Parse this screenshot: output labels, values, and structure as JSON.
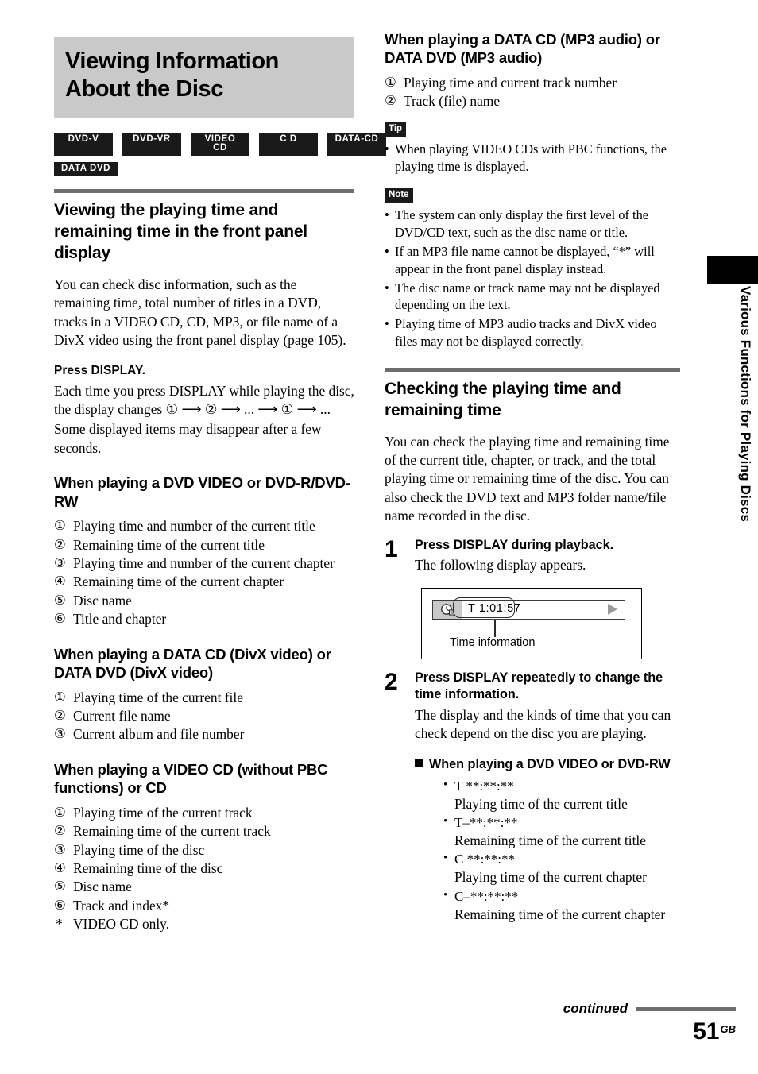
{
  "document": {
    "title": "Viewing Information About the Disc",
    "side_tab_text": "Various Functions for Playing Discs",
    "footer": {
      "continued_label": "continued",
      "page_number": "51",
      "page_suffix": "GB"
    }
  },
  "disc_badges": {
    "row1": [
      "DVD-V",
      "DVD-VR",
      "VIDEO CD",
      "C D",
      "DATA-CD"
    ],
    "row2": [
      "DATA DVD"
    ]
  },
  "left_column": {
    "section1": {
      "heading": "Viewing the playing time and remaining time in the front panel display",
      "paragraph": "You can check disc information, such as the remaining time, total number of titles in a DVD, tracks in a VIDEO CD, CD, MP3, or file name of a DivX video using the front panel display (page 105).",
      "press_display_heading": "Press DISPLAY.",
      "press_display_text_1": "Each time you press DISPLAY while playing the disc, the display changes ",
      "press_display_text_2": "Some displayed items may disappear after a few seconds."
    },
    "dvd_video_block": {
      "heading": "When playing a DVD VIDEO or DVD-R/DVD-RW",
      "items": [
        "Playing time and number of the current title",
        "Remaining time of the current title",
        "Playing time and number of the current chapter",
        "Remaining time of the current chapter",
        "Disc name",
        "Title and chapter"
      ]
    },
    "divx_block": {
      "heading": "When playing a DATA CD (DivX video) or DATA DVD (DivX video)",
      "items": [
        "Playing time of the current file",
        "Current file name",
        "Current album and file number"
      ]
    },
    "videocd_block": {
      "heading": "When playing a VIDEO CD (without PBC functions) or CD",
      "items": [
        "Playing time of the current track",
        "Remaining time of the current track",
        "Playing time of the disc",
        "Remaining time of the disc",
        "Disc name",
        "Track and index*"
      ],
      "footnote": "VIDEO CD only."
    }
  },
  "right_column": {
    "mp3_block": {
      "heading": "When playing a DATA CD (MP3 audio) or DATA DVD (MP3 audio)",
      "items": [
        "Playing time and current track number",
        "Track (file) name"
      ]
    },
    "tip": {
      "label": "Tip",
      "items": [
        "When playing VIDEO CDs with PBC functions, the playing time is displayed."
      ]
    },
    "note": {
      "label": "Note",
      "items": [
        "The system can only display the first level of the DVD/CD text, such as the disc name or title.",
        "If an MP3 file name cannot be displayed, “*” will appear in the front panel display instead.",
        "The disc name or track name may not be displayed depending on the text.",
        "Playing time of MP3 audio tracks and DivX video files may not be displayed correctly."
      ]
    },
    "section2": {
      "heading": "Checking the playing time and remaining time",
      "paragraph": "You can check the playing time and remaining time of the current title, chapter, or track, and the total playing time or remaining time of the disc. You can also check the DVD text and MP3 folder name/file name recorded in the disc."
    },
    "step1": {
      "number": "1",
      "title": "Press DISPLAY during playback.",
      "text": "The following display appears."
    },
    "illustration": {
      "time_value": "T   1:01:57",
      "caption": "Time information",
      "clock_icon": "clock-icon",
      "play_icon": "play-triangle-icon"
    },
    "step2": {
      "number": "2",
      "title": "Press DISPLAY repeatedly to change the time information.",
      "text": "The display and the kinds of time that you can check depend on the disc you are playing."
    },
    "dvd_time_block": {
      "heading": "When playing a DVD VIDEO or DVD-RW",
      "items": [
        {
          "code": "T **:**:**",
          "desc": "Playing time of the current title"
        },
        {
          "code": "T–**:**:**",
          "desc": "Remaining time of the current title"
        },
        {
          "code": "C **:**:**",
          "desc": "Playing time of the current chapter"
        },
        {
          "code": "C–**:**:**",
          "desc": "Remaining time of the current chapter"
        }
      ]
    }
  },
  "glyphs": {
    "circled": [
      "①",
      "②",
      "③",
      "④",
      "⑤",
      "⑥"
    ],
    "arrow": "→",
    "ellipsis": "...",
    "star": "*"
  },
  "colors": {
    "title_band_bg": "#c9c9c9",
    "rule_gray": "#6e6e6e",
    "badge_bg": "#1a1a1a",
    "text": "#000000"
  }
}
